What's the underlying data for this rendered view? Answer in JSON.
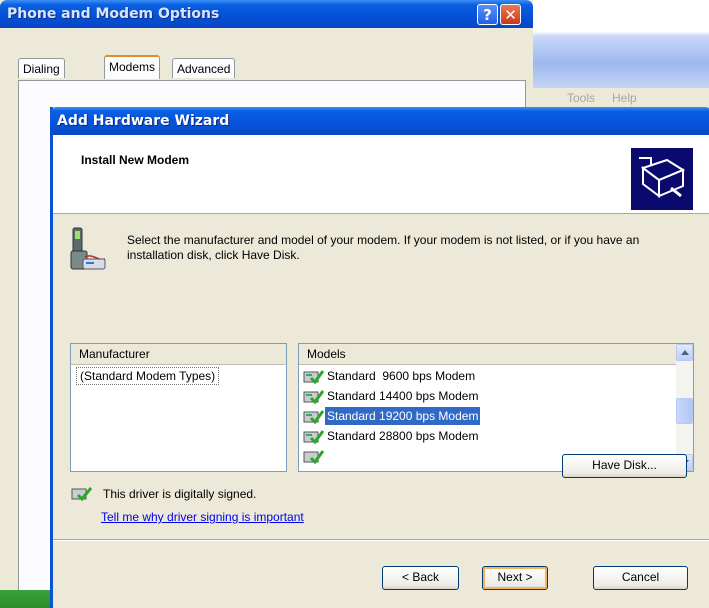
{
  "background_window": {
    "title": "Phone and Modem Options",
    "help_glyph": "?",
    "close_glyph": "✕",
    "tabs": [
      {
        "label": "Dialing Rules",
        "active": false
      },
      {
        "label": "Modems",
        "active": true
      },
      {
        "label": "Advanced",
        "active": false
      }
    ],
    "menu_fragment": [
      "Tools",
      "Help"
    ]
  },
  "wizard": {
    "title": "Add Hardware Wizard",
    "header_title": "Install New Modem",
    "intro": "Select the manufacturer and model of your modem. If your modem is not listed, or if you have an installation disk, click Have Disk.",
    "manufacturer": {
      "header": "Manufacturer",
      "items": [
        "(Standard Modem Types)"
      ],
      "selected": "(Standard Modem Types)"
    },
    "models": {
      "header": "Models",
      "items": [
        {
          "label": "Standard  9600 bps Modem",
          "selected": false
        },
        {
          "label": "Standard 14400 bps Modem",
          "selected": false
        },
        {
          "label": "Standard 19200 bps Modem",
          "selected": true
        },
        {
          "label": "Standard 28800 bps Modem",
          "selected": false
        }
      ]
    },
    "signed_text": "This driver is digitally signed.",
    "signing_link": "Tell me why driver signing is important",
    "buttons": {
      "have_disk": "Have Disk...",
      "back": "< Back",
      "next": "Next >",
      "cancel": "Cancel"
    }
  },
  "colors": {
    "titlebar_blue": "#0554dc",
    "selection": "#316ac5",
    "dialog_face": "#ece9d8",
    "link": "#0000ee"
  }
}
